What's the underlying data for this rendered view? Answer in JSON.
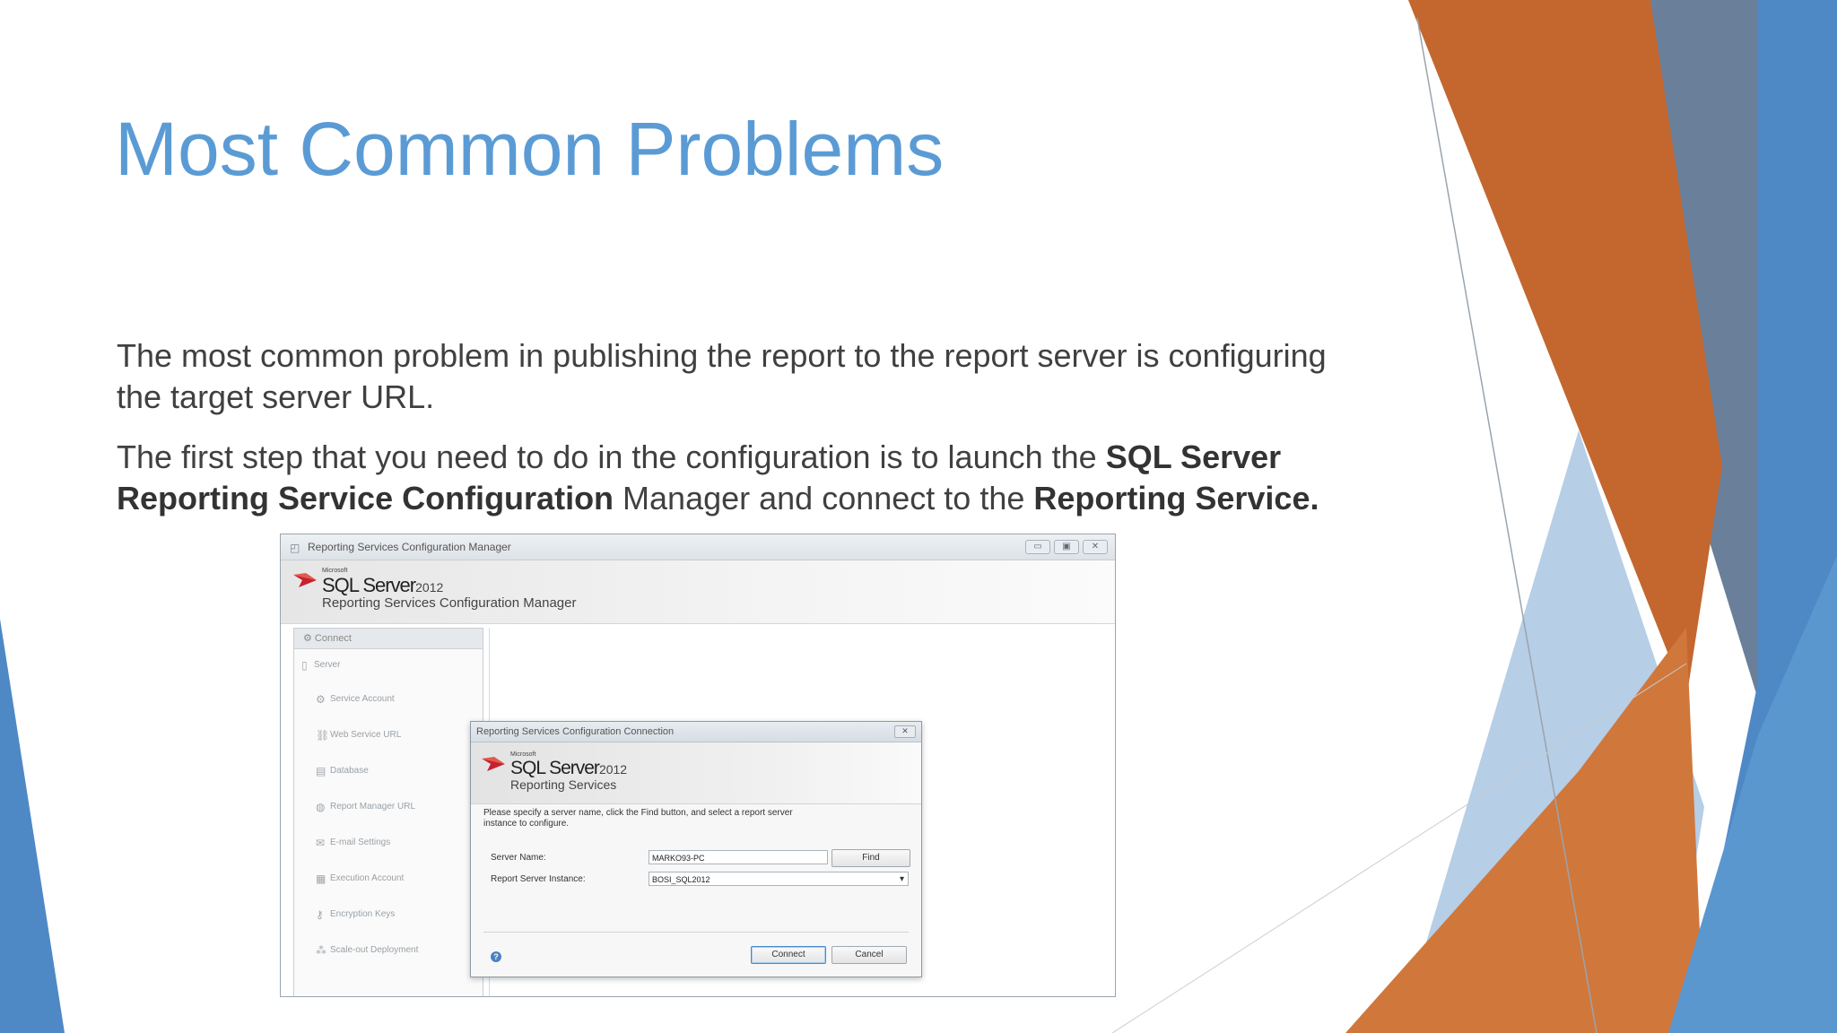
{
  "slide": {
    "title": "Most Common Problems",
    "p1": "The most common problem in publishing the report to the report server is configuring the target server URL.",
    "p2_a": "The first step that you need to do in the configuration is to launch the ",
    "p2_b": "SQL Server Reporting Service Configuration",
    "p2_c": " Manager and connect to the ",
    "p2_d": "Reporting Service."
  },
  "colors": {
    "title": "#5b9bd5",
    "orange": "#c3672f",
    "blue": "#4e89c6",
    "light_blue": "#a9c6e2",
    "slate": "#6a7f99"
  },
  "window": {
    "title": "Reporting Services Configuration Manager",
    "brand_ms": "Microsoft",
    "brand_sql": "SQL Server",
    "brand_ver": "2012",
    "brand_sub": "Reporting Services Configuration Manager",
    "nav_head": "Connect",
    "nav": [
      {
        "label": "Server",
        "icon": "server-icon"
      },
      {
        "label": "Service Account",
        "icon": "account-icon"
      },
      {
        "label": "Web Service URL",
        "icon": "web-icon"
      },
      {
        "label": "Database",
        "icon": "database-icon"
      },
      {
        "label": "Report Manager URL",
        "icon": "globe-icon"
      },
      {
        "label": "E-mail Settings",
        "icon": "mail-icon"
      },
      {
        "label": "Execution Account",
        "icon": "user-icon"
      },
      {
        "label": "Encryption Keys",
        "icon": "key-icon"
      },
      {
        "label": "Scale-out Deployment",
        "icon": "scale-icon"
      }
    ]
  },
  "dialog": {
    "title": "Reporting Services Configuration Connection",
    "brand_ms": "Microsoft",
    "brand_sql": "SQL Server",
    "brand_ver": "2012",
    "brand_sub": "Reporting Services",
    "instructions": "Please specify a server name, click the Find button, and select a report server instance to configure.",
    "server_name_label": "Server Name:",
    "server_name_value": "MARKO93-PC",
    "find_label": "Find",
    "instance_label": "Report Server Instance:",
    "instance_value": "BOSI_SQL2012",
    "connect_label": "Connect",
    "cancel_label": "Cancel"
  }
}
